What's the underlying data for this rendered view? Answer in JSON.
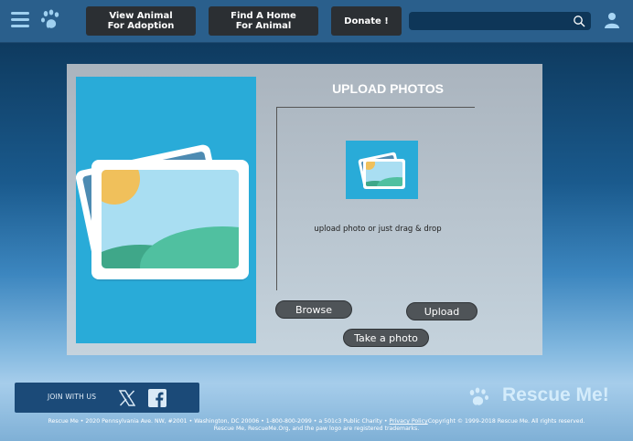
{
  "nav": {
    "adoption_label": "View Animal\nFor Adoption",
    "find_home_label": "Find A Home\nFor Animal",
    "donate_label": "Donate !",
    "search_placeholder": ""
  },
  "upload": {
    "title": "UPLOAD PHOTOS",
    "hint": "upload photo or just drag & drop",
    "browse_label": "Browse",
    "upload_label": "Upload",
    "take_photo_label": "Take a photo"
  },
  "footer": {
    "join_label": "JOIN WITH US",
    "brand_name": "Rescue Me!",
    "legal_prefix": "Rescue Me • 2020 Pennsylvania Ave. NW, #2001 • Washington, DC 20006 • 1-800-800-2099 • a 501c3 Public Charity • ",
    "privacy_link": "Privacy Policy",
    "legal_suffix": "Copyright © 1999-2018 Rescue Me. All rights reserved.",
    "legal_line2": "Rescue Me, RescueMe.Org, and the paw logo are registered trademarks."
  },
  "colors": {
    "accent": "#29abd8",
    "topbar": "#2a5f8c",
    "button_dark": "#2b2f33"
  },
  "icons": [
    "menu-icon",
    "paw-icon",
    "search-icon",
    "user-icon",
    "image-icon",
    "x-icon",
    "facebook-icon"
  ]
}
